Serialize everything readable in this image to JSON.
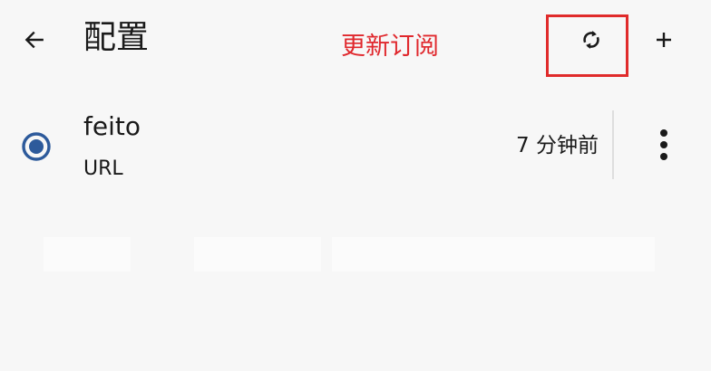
{
  "header": {
    "back_icon": "arrow-back-icon",
    "title": "配置",
    "refresh_icon": "refresh-sync-icon",
    "add_icon": "plus-icon"
  },
  "annotation": {
    "text": "更新订阅",
    "color": "#e0282d",
    "highlight_color": "#e02b2b"
  },
  "profiles": [
    {
      "name": "feito",
      "type": "URL",
      "updated": "7 分钟前",
      "selected": true,
      "radio_icon": "radio-selected-icon",
      "menu_icon": "more-vert-icon"
    }
  ],
  "colors": {
    "accent": "#2d5a9b",
    "background": "#f7f7f7",
    "text": "#1a1a1a"
  }
}
